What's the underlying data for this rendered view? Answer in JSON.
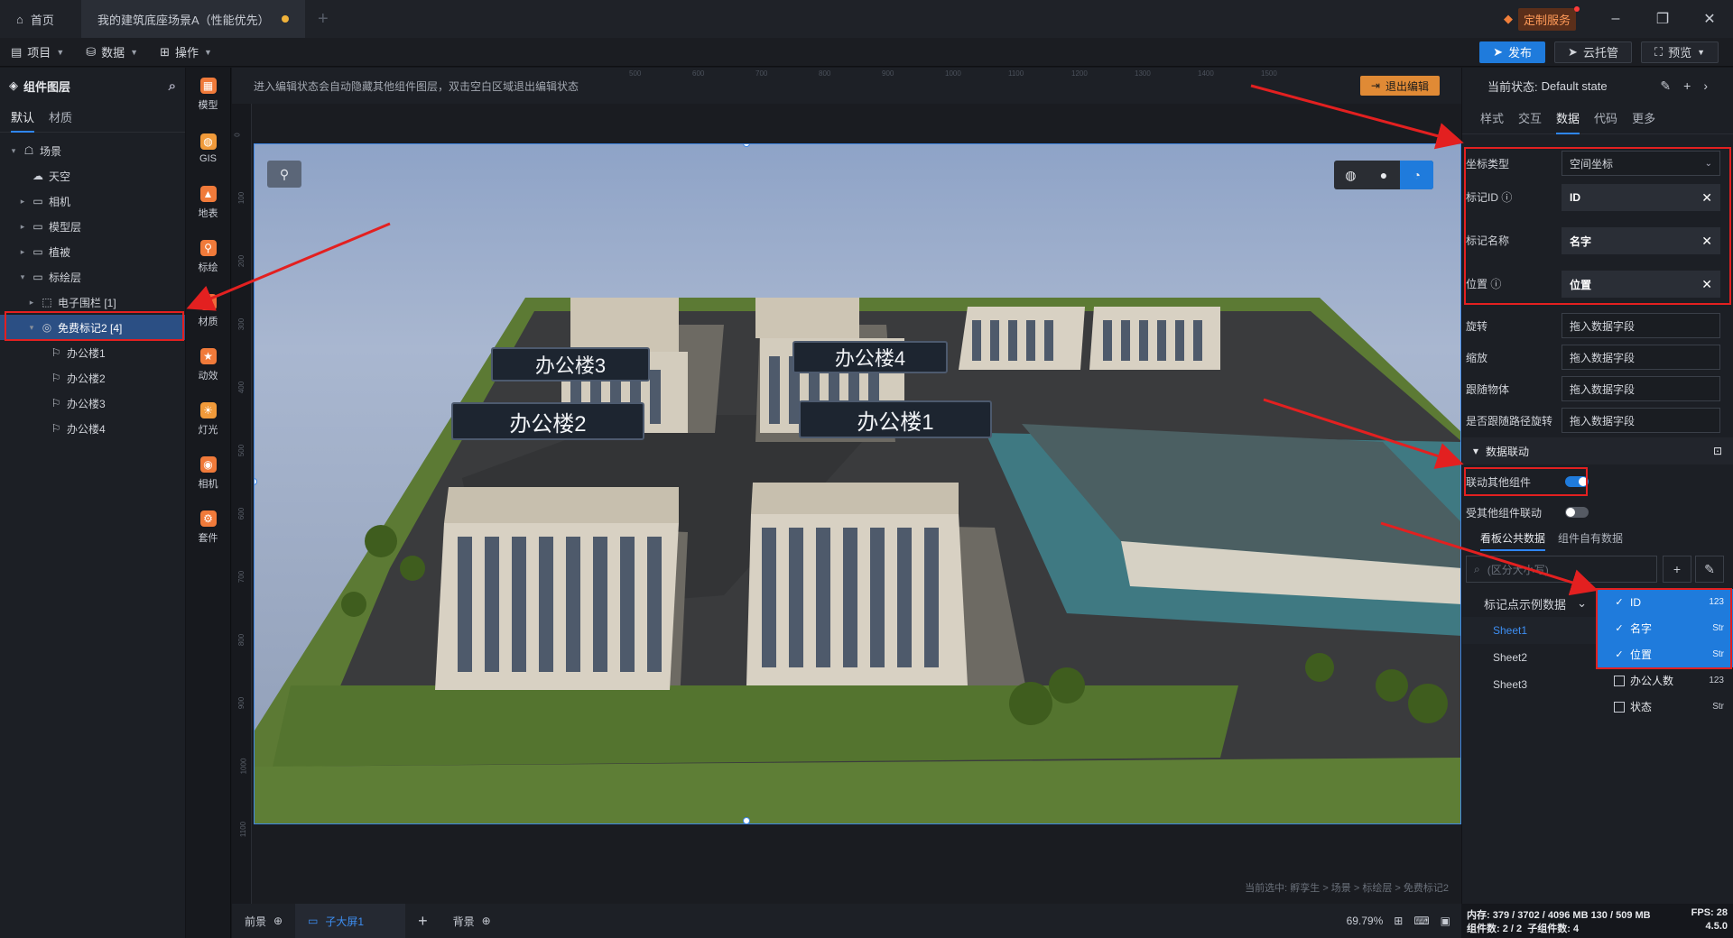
{
  "titlebar": {
    "home_label": "首页",
    "doc_tab": "我的建筑底座场景A（性能优先）",
    "custom_service": "定制服务"
  },
  "menubar": {
    "items": [
      "项目",
      "数据",
      "操作"
    ],
    "publish": "发布",
    "cloud": "云托管",
    "preview": "预览"
  },
  "left": {
    "title": "组件图层",
    "tabs": [
      "默认",
      "材质"
    ],
    "tree": [
      {
        "label": "场景",
        "indent": 0,
        "arrow": "▾",
        "icon": "☖"
      },
      {
        "label": "天空",
        "indent": 1,
        "arrow": "",
        "icon": "☁"
      },
      {
        "label": "相机",
        "indent": 1,
        "arrow": "▸",
        "icon": "▭"
      },
      {
        "label": "模型层",
        "indent": 1,
        "arrow": "▸",
        "icon": "▭"
      },
      {
        "label": "植被",
        "indent": 1,
        "arrow": "▸",
        "icon": "▭"
      },
      {
        "label": "标绘层",
        "indent": 1,
        "arrow": "▾",
        "icon": "▭"
      },
      {
        "label": "电子围栏 [1]",
        "indent": 2,
        "arrow": "▸",
        "icon": "⬚"
      },
      {
        "label": "免费标记2 [4]",
        "indent": 2,
        "arrow": "▾",
        "icon": "◎",
        "selected": true
      },
      {
        "label": "办公楼1",
        "indent": 3,
        "arrow": "",
        "icon": "⚐"
      },
      {
        "label": "办公楼2",
        "indent": 3,
        "arrow": "",
        "icon": "⚐"
      },
      {
        "label": "办公楼3",
        "indent": 3,
        "arrow": "",
        "icon": "⚐"
      },
      {
        "label": "办公楼4",
        "indent": 3,
        "arrow": "",
        "icon": "⚐"
      }
    ]
  },
  "tools": [
    {
      "label": "模型",
      "color": "#f07a3a",
      "icon": "▦"
    },
    {
      "label": "GIS",
      "color": "#f09a3a",
      "icon": "◍"
    },
    {
      "label": "地表",
      "color": "#f07a3a",
      "icon": "▲"
    },
    {
      "label": "标绘",
      "color": "#f07a3a",
      "icon": "⚲"
    },
    {
      "label": "材质",
      "color": "#f06a3a",
      "icon": "◐"
    },
    {
      "label": "动效",
      "color": "#f07a3a",
      "icon": "★"
    },
    {
      "label": "灯光",
      "color": "#f09a3a",
      "icon": "☀"
    },
    {
      "label": "相机",
      "color": "#f07a3a",
      "icon": "◉"
    },
    {
      "label": "套件",
      "color": "#f07a3a",
      "icon": "⚙"
    }
  ],
  "canvas": {
    "hint": "进入编辑状态会自动隐藏其他组件图层，双击空白区域退出编辑状态",
    "exit_edit": "退出编辑",
    "ruler_top": [
      "500",
      "600",
      "700",
      "800",
      "900",
      "1000",
      "1100",
      "1200",
      "1300",
      "1400",
      "1500"
    ],
    "ruler_left": [
      "0",
      "100",
      "200",
      "300",
      "400",
      "500",
      "600",
      "700",
      "800",
      "900",
      "1000",
      "1100"
    ],
    "buildings": [
      "办公楼3",
      "办公楼4",
      "办公楼2",
      "办公楼1"
    ],
    "breadcrumb": "当前选中: 孵孪生 > 场景 > 标绘层 > 免费标记2"
  },
  "bottom": {
    "front": "前景",
    "screen": "子大屏1",
    "back": "背景",
    "zoom": "69.79%"
  },
  "right": {
    "state_label": "当前状态:",
    "state_value": "Default state",
    "tabs": [
      "样式",
      "交互",
      "数据",
      "代码",
      "更多"
    ],
    "coord_type_label": "坐标类型",
    "coord_type_value": "空间坐标",
    "marker_id_label": "标记ID",
    "marker_id_value": "ID",
    "marker_name_label": "标记名称",
    "marker_name_value": "名字",
    "position_label": "位置",
    "position_value": "位置",
    "rotate_label": "旋转",
    "scale_label": "缩放",
    "follow_label": "跟随物体",
    "path_rotate_label": "是否跟随路径旋转",
    "drag_placeholder": "拖入数据字段",
    "section_label": "数据联动",
    "link_others": "联动其他组件",
    "linked_by": "受其他组件联动",
    "ds_tabs": [
      "看板公共数据",
      "组件自有数据"
    ],
    "search_placeholder": "(区分大小写)",
    "dataset": "标记点示例数据",
    "sheets": [
      "Sheet1",
      "Sheet2",
      "Sheet3"
    ],
    "fields": [
      {
        "name": "ID",
        "type": "123",
        "checked": true
      },
      {
        "name": "名字",
        "type": "Str",
        "checked": true
      },
      {
        "name": "位置",
        "type": "Str",
        "checked": true
      },
      {
        "name": "办公人数",
        "type": "123",
        "checked": false
      },
      {
        "name": "状态",
        "type": "Str",
        "checked": false
      }
    ]
  },
  "status": {
    "memory": "内存: 379 / 3702 / 4096 MB 130 / 509 MB",
    "fps": "FPS: 28",
    "components": "组件数: 2 / 2",
    "sub_components": "子组件数: 4",
    "version": "4.5.0"
  },
  "colors": {
    "accent": "#1f7bdc",
    "highlight": "#e32020",
    "warning": "#e08a35"
  }
}
